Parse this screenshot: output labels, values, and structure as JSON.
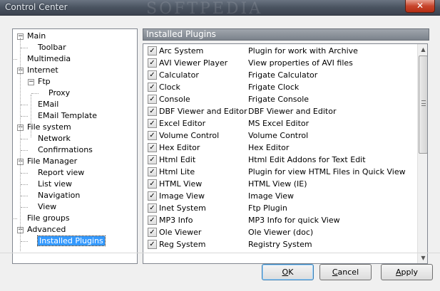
{
  "window": {
    "title": "Control Center",
    "watermark": "SOFTPEDIA",
    "close_label": "✕"
  },
  "tree": {
    "items": [
      {
        "label": "Main",
        "expander": "−"
      },
      {
        "label": "Toolbar"
      },
      {
        "label": "Multimedia"
      },
      {
        "label": "Internet",
        "expander": "−"
      },
      {
        "label": "Ftp",
        "expander": "−"
      },
      {
        "label": "Proxy"
      },
      {
        "label": "EMail"
      },
      {
        "label": "EMail Template"
      },
      {
        "label": "File system",
        "expander": "−"
      },
      {
        "label": "Network"
      },
      {
        "label": "Confirmations"
      },
      {
        "label": "File Manager",
        "expander": "−"
      },
      {
        "label": "Report view"
      },
      {
        "label": "List view"
      },
      {
        "label": "Navigation"
      },
      {
        "label": "View"
      },
      {
        "label": "File groups"
      },
      {
        "label": "Advanced",
        "expander": "−"
      },
      {
        "label": "Installed Plugins",
        "selected": true
      }
    ]
  },
  "panel": {
    "header": "Installed Plugins",
    "plugins": [
      {
        "name": "Arc System",
        "description": "Plugin for work with Archive",
        "checked": true
      },
      {
        "name": "AVI Viewer Player",
        "description": "View properties of AVI files",
        "checked": true
      },
      {
        "name": "Calculator",
        "description": "Frigate Calculator",
        "checked": true
      },
      {
        "name": "Clock",
        "description": "Frigate Clock",
        "checked": true
      },
      {
        "name": "Console",
        "description": "Frigate Console",
        "checked": true
      },
      {
        "name": "DBF Viewer and Editor",
        "description": "DBF Viewer and Editor",
        "checked": true
      },
      {
        "name": "Excel Editor",
        "description": "MS Excel Editor",
        "checked": true
      },
      {
        "name": "Volume Control",
        "description": "Volume Control",
        "checked": true
      },
      {
        "name": "Hex Editor",
        "description": "Hex Editor",
        "checked": true
      },
      {
        "name": "Html Edit",
        "description": "Html Edit Addons for Text Edit",
        "checked": true
      },
      {
        "name": "Html Lite",
        "description": "Plugin for view HTML Files in Quick View",
        "checked": true
      },
      {
        "name": "HTML View",
        "description": "HTML View (IE)",
        "checked": true
      },
      {
        "name": "Image View",
        "description": "Image View",
        "checked": true
      },
      {
        "name": "Inet System",
        "description": "Ftp Plugin",
        "checked": true
      },
      {
        "name": "MP3 Info",
        "description": "MP3 Info for quick View",
        "checked": true
      },
      {
        "name": "Ole Viewer",
        "description": "Ole Viewer (doc)",
        "checked": true
      },
      {
        "name": "Reg System",
        "description": "Registry System",
        "checked": true
      }
    ]
  },
  "buttons": {
    "ok": {
      "accel": "O",
      "rest": "K"
    },
    "cancel": {
      "accel": "C",
      "rest": "ancel"
    },
    "apply": {
      "accel": "A",
      "rest": "pply"
    }
  },
  "icons": {
    "check": "check-icon",
    "up": "scroll-up-icon",
    "down": "scroll-down-icon"
  }
}
